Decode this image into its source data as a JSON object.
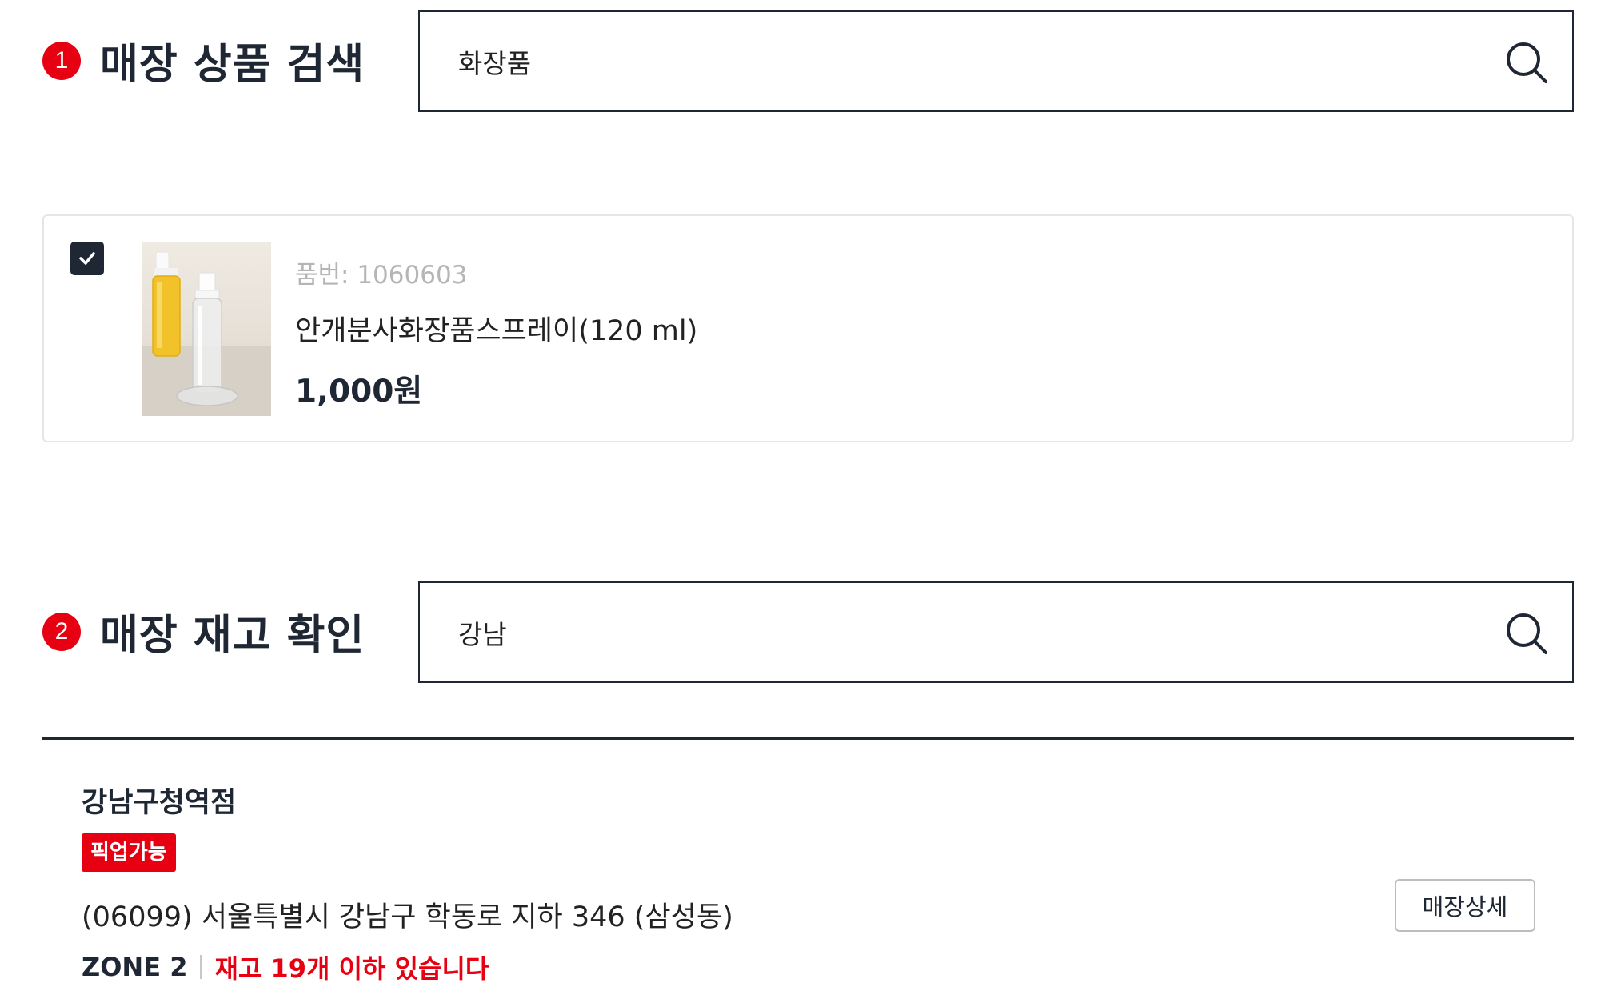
{
  "product_search": {
    "step": "1",
    "title": "매장 상품 검색",
    "query": "화장품"
  },
  "product": {
    "checked": true,
    "code": "품번: 1060603",
    "name": "안개분사화장품스프레이(120 ml)",
    "price": "1,000원"
  },
  "stock_check": {
    "step": "2",
    "title": "매장 재고 확인",
    "query": "강남"
  },
  "store": {
    "name": "강남구청역점",
    "badge": "픽업가능",
    "address": "(06099) 서울특별시 강남구 학동로 지하 346 (삼성동)",
    "zone": "ZONE 2",
    "stock": "재고 19개 이하 있습니다",
    "detail_button": "매장상세"
  },
  "colors": {
    "accent": "#e60012",
    "dark": "#1e2733"
  },
  "icons": {
    "search": "search-icon",
    "check": "check-icon"
  }
}
